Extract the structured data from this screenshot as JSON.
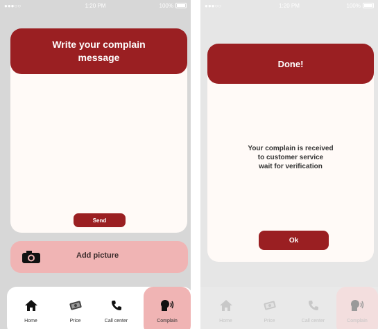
{
  "status": {
    "signal": "●●●○○",
    "time": "1:20 PM",
    "battery": "100%"
  },
  "left": {
    "title": "Write your complain message",
    "send_label": "Send",
    "add_picture_label": "Add picture"
  },
  "right": {
    "title": "Done!",
    "message_line1": "Your complain is received",
    "message_line2": "to customer service",
    "message_line3": "wait for verification",
    "ok_label": "Ok"
  },
  "tabs": [
    {
      "label": "Home",
      "icon": "home-icon"
    },
    {
      "label": "Price",
      "icon": "price-icon"
    },
    {
      "label": "Call center",
      "icon": "phone-icon"
    },
    {
      "label": "Complain",
      "icon": "complain-icon"
    }
  ],
  "colors": {
    "accent": "#9a1f22",
    "soft": "#f0b4b4",
    "card": "#fffaf7",
    "bg": "#d7d7d7"
  }
}
